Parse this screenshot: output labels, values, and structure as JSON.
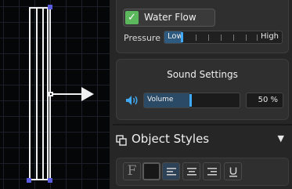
{
  "canvas": {
    "shape": "text-cursor-shape",
    "arrow": "right-arrow"
  },
  "sound_toggle": {
    "label": "Water Flow",
    "checked": true
  },
  "pressure": {
    "label": "Pressure",
    "low_label": "Low",
    "high_label": "High",
    "level": 0.12
  },
  "sound_settings": {
    "title": "Sound Settings",
    "volume_label": "Volume",
    "volume_value": "50 %",
    "volume_level": 0.5
  },
  "object_styles": {
    "title": "Object Styles"
  },
  "toolbar": {
    "font_label": "F",
    "buttons": [
      "font-button",
      "fill-swatch",
      "align-left",
      "align-center",
      "align-right",
      "underline"
    ]
  },
  "colors": {
    "accent": "#3fa9f5",
    "check": "#5cb85c",
    "panel": "#2f2f2f"
  }
}
